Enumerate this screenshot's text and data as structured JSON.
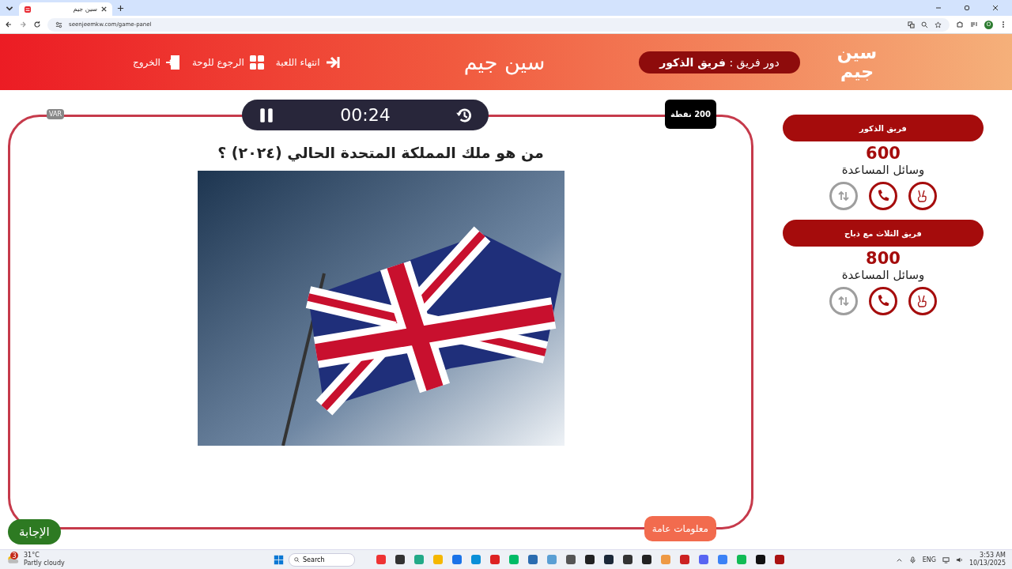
{
  "browser": {
    "tab_title": "سين جيم",
    "url": "seenjeemkw.com/game-panel",
    "profile_initial": "O"
  },
  "header": {
    "logo_lines": [
      "سين",
      "جيم"
    ],
    "title": "سين جيم",
    "turn": "دور فريق : **فريق الذكور**",
    "actions": [
      {
        "kind": "end",
        "label": "انتهاء اللعبة"
      },
      {
        "kind": "board",
        "label": "الرجوع للوحة"
      },
      {
        "kind": "exit",
        "label": "الخروج"
      }
    ]
  },
  "game": {
    "points": "200 نقطة",
    "timer": "00:24",
    "var": "VAR",
    "question": "من هو ملك المملكة المتحدة الحالي (٢٠٢٤) ؟",
    "category": "معلومات عامة",
    "answer_button": "الإجابة"
  },
  "teams": [
    {
      "name": "فريق الذكور",
      "score": "600",
      "lifelines_label": "وسائل المساعدة",
      "lifelines": [
        {
          "kind": "two-fingers",
          "available": true
        },
        {
          "kind": "phone",
          "available": true
        },
        {
          "kind": "swap",
          "available": false
        }
      ]
    },
    {
      "name": "فريق الثلاث مع ذباح",
      "score": "800",
      "lifelines_label": "وسائل المساعدة",
      "lifelines": [
        {
          "kind": "two-fingers",
          "available": true
        },
        {
          "kind": "phone",
          "available": true
        },
        {
          "kind": "swap",
          "available": false
        }
      ]
    }
  ],
  "taskbar": {
    "weather_badge": "3",
    "temperature": "31°C",
    "weather": "Partly cloudy",
    "search": "Search",
    "language": "ENG",
    "time": "3:53 AM",
    "date": "10/13/2025"
  }
}
